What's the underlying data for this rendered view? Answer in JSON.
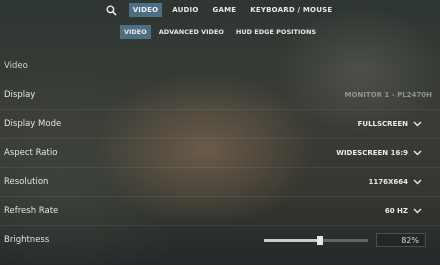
{
  "topnav": {
    "search_icon": "search-icon",
    "tabs": [
      {
        "label": "VIDEO",
        "active": true
      },
      {
        "label": "AUDIO",
        "active": false
      },
      {
        "label": "GAME",
        "active": false
      },
      {
        "label": "KEYBOARD / MOUSE",
        "active": false
      }
    ]
  },
  "subnav": {
    "tabs": [
      {
        "label": "VIDEO",
        "active": true
      },
      {
        "label": "ADVANCED VIDEO",
        "active": false
      },
      {
        "label": "HUD EDGE POSITIONS",
        "active": false
      }
    ]
  },
  "section": {
    "title": "Video"
  },
  "settings": {
    "display": {
      "label": "Display",
      "value": "MONITOR 1 - PL2470H"
    },
    "display_mode": {
      "label": "Display Mode",
      "value": "FULLSCREEN"
    },
    "aspect_ratio": {
      "label": "Aspect Ratio",
      "value": "WIDESCREEN 16:9"
    },
    "resolution": {
      "label": "Resolution",
      "value": "1176X664"
    },
    "refresh_rate": {
      "label": "Refresh Rate",
      "value": "60 HZ"
    },
    "brightness": {
      "label": "Brightness",
      "value": "82%",
      "slider_fraction": 0.54
    }
  },
  "colors": {
    "accent": "#4d6f83"
  }
}
